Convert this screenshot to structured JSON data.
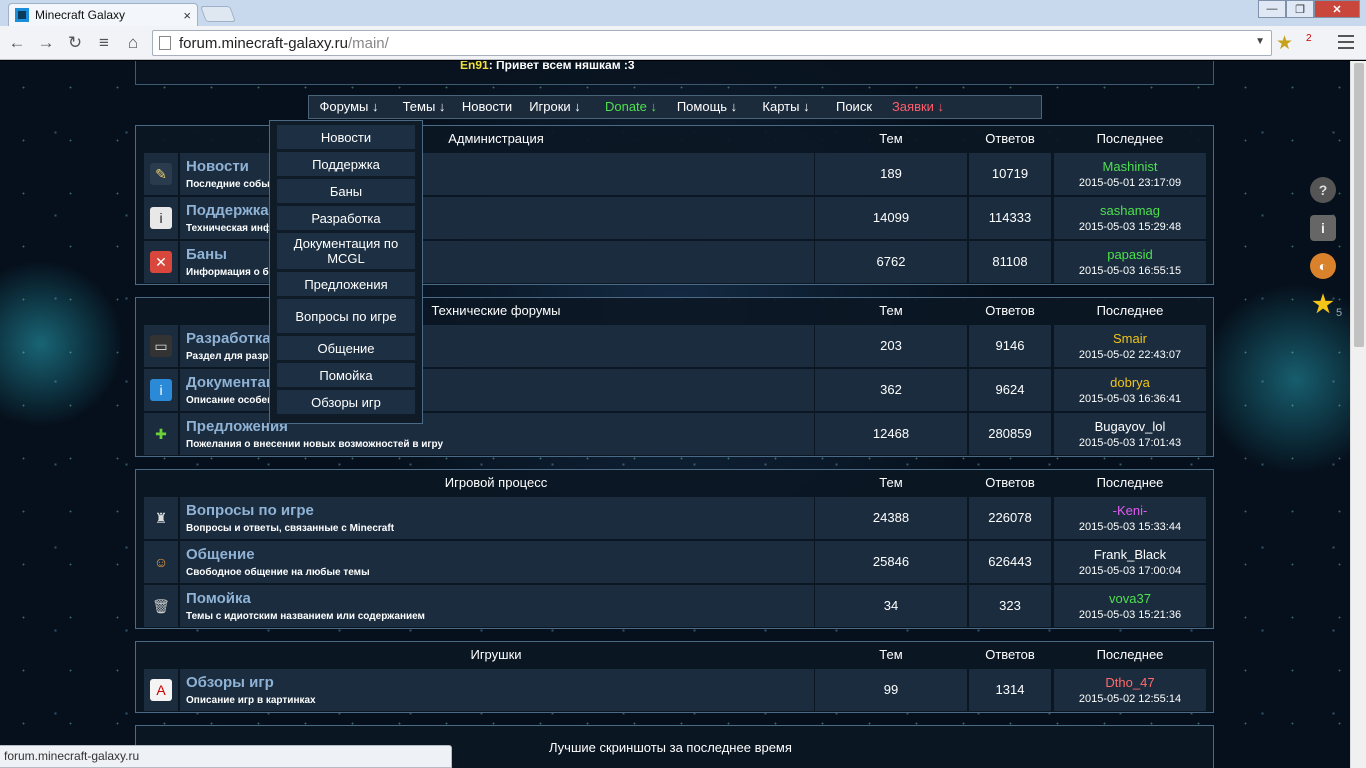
{
  "browser": {
    "tab_title": "Minecraft Galaxy",
    "tab_close": "×",
    "url_host": "forum.minecraft-galaxy.ru",
    "url_path": "/main/",
    "ext_badge": "2",
    "status_url": "forum.minecraft-galaxy.ru"
  },
  "shoutbox": {
    "nick": "En91",
    "message": ": Привет всем няшкам :3"
  },
  "nav": [
    {
      "label": "Форумы ↓",
      "color": "#ffffff"
    },
    {
      "label": "Темы ↓",
      "color": "#ffffff"
    },
    {
      "label": "Новости",
      "color": "#ffffff"
    },
    {
      "label": "Игроки ↓",
      "color": "#ffffff"
    },
    {
      "label": "Donate ↓",
      "color": "#4ee04e"
    },
    {
      "label": "Помощь ↓",
      "color": "#ffffff"
    },
    {
      "label": "Карты ↓",
      "color": "#ffffff"
    },
    {
      "label": "Поиск",
      "color": "#ffffff"
    },
    {
      "label": "Заявки ↓",
      "color": "#ff5c6a"
    }
  ],
  "dropdown": [
    "Новости",
    "Поддержка",
    "Баны",
    "Разработка",
    "Документация по MCGL",
    "Предложения",
    "Вопросы по игре",
    "Общение",
    "Помойка",
    "Обзоры игр"
  ],
  "columns": {
    "topics": "Тем",
    "posts": "Ответов",
    "last": "Последнее"
  },
  "sections": [
    {
      "name": "Администрация",
      "forums": [
        {
          "title": "Новости",
          "desc": "Последние события",
          "icon": "pen-icon",
          "topics": "189",
          "posts": "10719",
          "user": "Mashinist",
          "user_color": "#4ee04e",
          "time": "2015-05-01 23:17:09"
        },
        {
          "title": "Поддержка",
          "desc": "Техническая информация",
          "icon": "info-icon",
          "topics": "14099",
          "posts": "114333",
          "user": "sashamag",
          "user_color": "#4ee04e",
          "time": "2015-05-03 15:29:48"
        },
        {
          "title": "Баны",
          "desc": "Информация о банах",
          "icon": "ban-icon",
          "topics": "6762",
          "posts": "81108",
          "user": "papasid",
          "user_color": "#4ee04e",
          "time": "2015-05-03 16:55:15"
        }
      ]
    },
    {
      "name": "Технические форумы",
      "forums": [
        {
          "title": "Разработка",
          "desc": "Раздел для разработчиков",
          "icon": "terminal-icon",
          "topics": "203",
          "posts": "9146",
          "user": "Smair",
          "user_color": "#f0c419",
          "time": "2015-05-02 22:43:07"
        },
        {
          "title": "Документация",
          "desc": "Описание особенностей",
          "icon": "info-circle-icon",
          "topics": "362",
          "posts": "9624",
          "user": "dobrya",
          "user_color": "#f0c419",
          "time": "2015-05-03 16:36:41"
        },
        {
          "title": "Предложения",
          "desc": "Пожелания о внесении новых возможностей в игру",
          "icon": "plus-icon",
          "topics": "12468",
          "posts": "280859",
          "user": "Bugayov_lol",
          "user_color": "#ffffff",
          "time": "2015-05-03 17:01:43"
        }
      ]
    },
    {
      "name": "Игровой процесс",
      "forums": [
        {
          "title": "Вопросы по игре",
          "desc": "Вопросы и ответы, связанные с Minecraft",
          "icon": "chess-icon",
          "topics": "24388",
          "posts": "226078",
          "user": "-Keni-",
          "user_color": "#e05cf0",
          "time": "2015-05-03 15:33:44"
        },
        {
          "title": "Общение",
          "desc": "Свободное общение на любые темы",
          "icon": "users-icon",
          "topics": "25846",
          "posts": "626443",
          "user": "Frank_Black",
          "user_color": "#ffffff",
          "time": "2015-05-03 17:00:04"
        },
        {
          "title": "Помойка",
          "desc": "Темы с идиотским названием или содержанием",
          "icon": "trash-icon",
          "topics": "34",
          "posts": "323",
          "user": "vova37",
          "user_color": "#4ee04e",
          "time": "2015-05-03 15:21:36"
        }
      ]
    },
    {
      "name": "Игрушки",
      "forums": [
        {
          "title": "Обзоры игр",
          "desc": "Описание игр в картинках",
          "icon": "card-icon",
          "topics": "99",
          "posts": "1314",
          "user": "Dtho_47",
          "user_color": "#ff6b6b",
          "time": "2015-05-02 12:55:14"
        }
      ]
    }
  ],
  "screenshots_title": "Лучшие скриншоты за последнее время",
  "sidebar_badge": "5"
}
